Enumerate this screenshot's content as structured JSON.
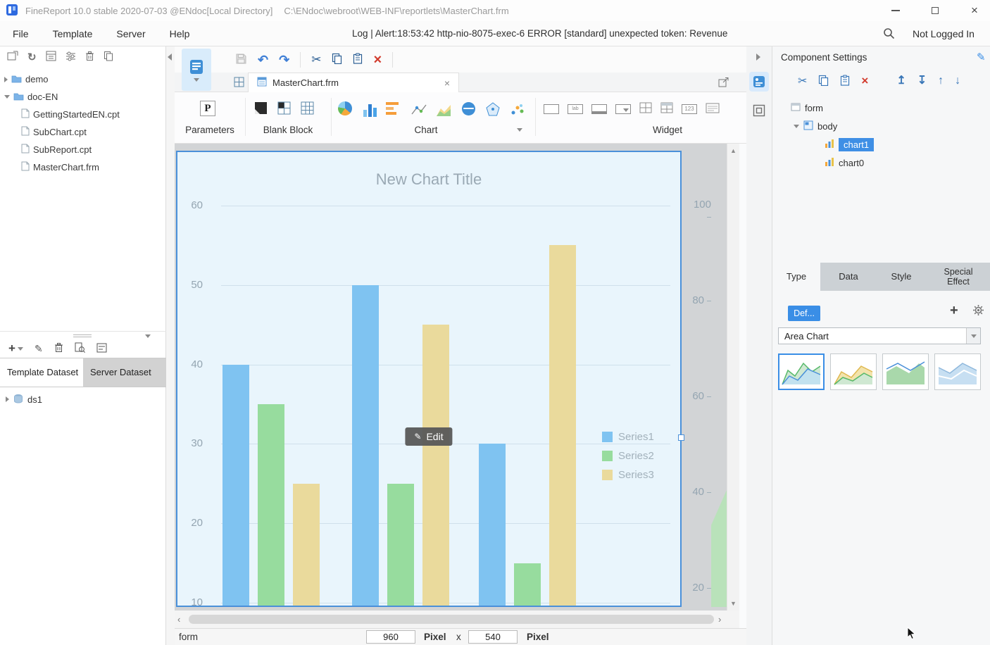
{
  "title_bar": {
    "app_title": "FineReport 10.0 stable 2020-07-03 @ENdoc[Local Directory]",
    "file_path": "C:\\ENdoc\\webroot\\WEB-INF\\reportlets\\MasterChart.frm"
  },
  "menu_bar": {
    "items": [
      {
        "label": "File"
      },
      {
        "label": "Template"
      },
      {
        "label": "Server"
      },
      {
        "label": "Help"
      }
    ],
    "log_message": "Log | Alert:18:53:42 http-nio-8075-exec-6 ERROR [standard] unexpected token: Revenue",
    "login_status": "Not Logged In"
  },
  "left_panel": {
    "folders": [
      {
        "label": "demo"
      },
      {
        "label": "doc-EN"
      }
    ],
    "files": [
      "GettingStartedEN.cpt",
      "SubChart.cpt",
      "SubReport.cpt",
      "MasterChart.frm"
    ],
    "dataset_tabs": [
      {
        "label": "Template Dataset"
      },
      {
        "label": "Server Dataset"
      }
    ],
    "dataset_name": "ds1"
  },
  "editor": {
    "tab_label": "MasterChart.frm",
    "ribbon": {
      "parameters_label": "Parameters",
      "blank_block_label": "Blank Block",
      "chart_label": "Chart",
      "widget_label": "Widget"
    },
    "edit_button_label": "Edit"
  },
  "chart_data": {
    "type": "bar",
    "title": "New Chart Title",
    "categories": [
      "",
      "",
      ""
    ],
    "series": [
      {
        "name": "Series1",
        "color": "#7FC3F1",
        "values": [
          40,
          50,
          30
        ]
      },
      {
        "name": "Series2",
        "color": "#97DC9E",
        "values": [
          35,
          25,
          15
        ]
      },
      {
        "name": "Series3",
        "color": "#EADA9C",
        "values": [
          25,
          45,
          55
        ]
      }
    ],
    "y_ticks": [
      60,
      50,
      40,
      30,
      20,
      10
    ],
    "ylim": [
      10,
      60
    ],
    "grid": true,
    "legend_position": "right",
    "secondary_chart_axis_ticks": [
      "100",
      "80",
      "60",
      "40",
      "20"
    ]
  },
  "status_bar": {
    "form_label": "form",
    "width_value": "960",
    "width_unit": "Pixel",
    "separator": "x",
    "height_value": "540",
    "height_unit": "Pixel"
  },
  "right_panel": {
    "header": "Component Settings",
    "tree": [
      {
        "label": "form"
      },
      {
        "label": "body"
      },
      {
        "label": "chart1"
      },
      {
        "label": "chart0"
      }
    ],
    "tabs": [
      {
        "label": "Type"
      },
      {
        "label": "Data"
      },
      {
        "label": "Style"
      },
      {
        "label": "Special Effect"
      }
    ],
    "def_button_label": "Def...",
    "chart_type_value": "Area Chart"
  }
}
